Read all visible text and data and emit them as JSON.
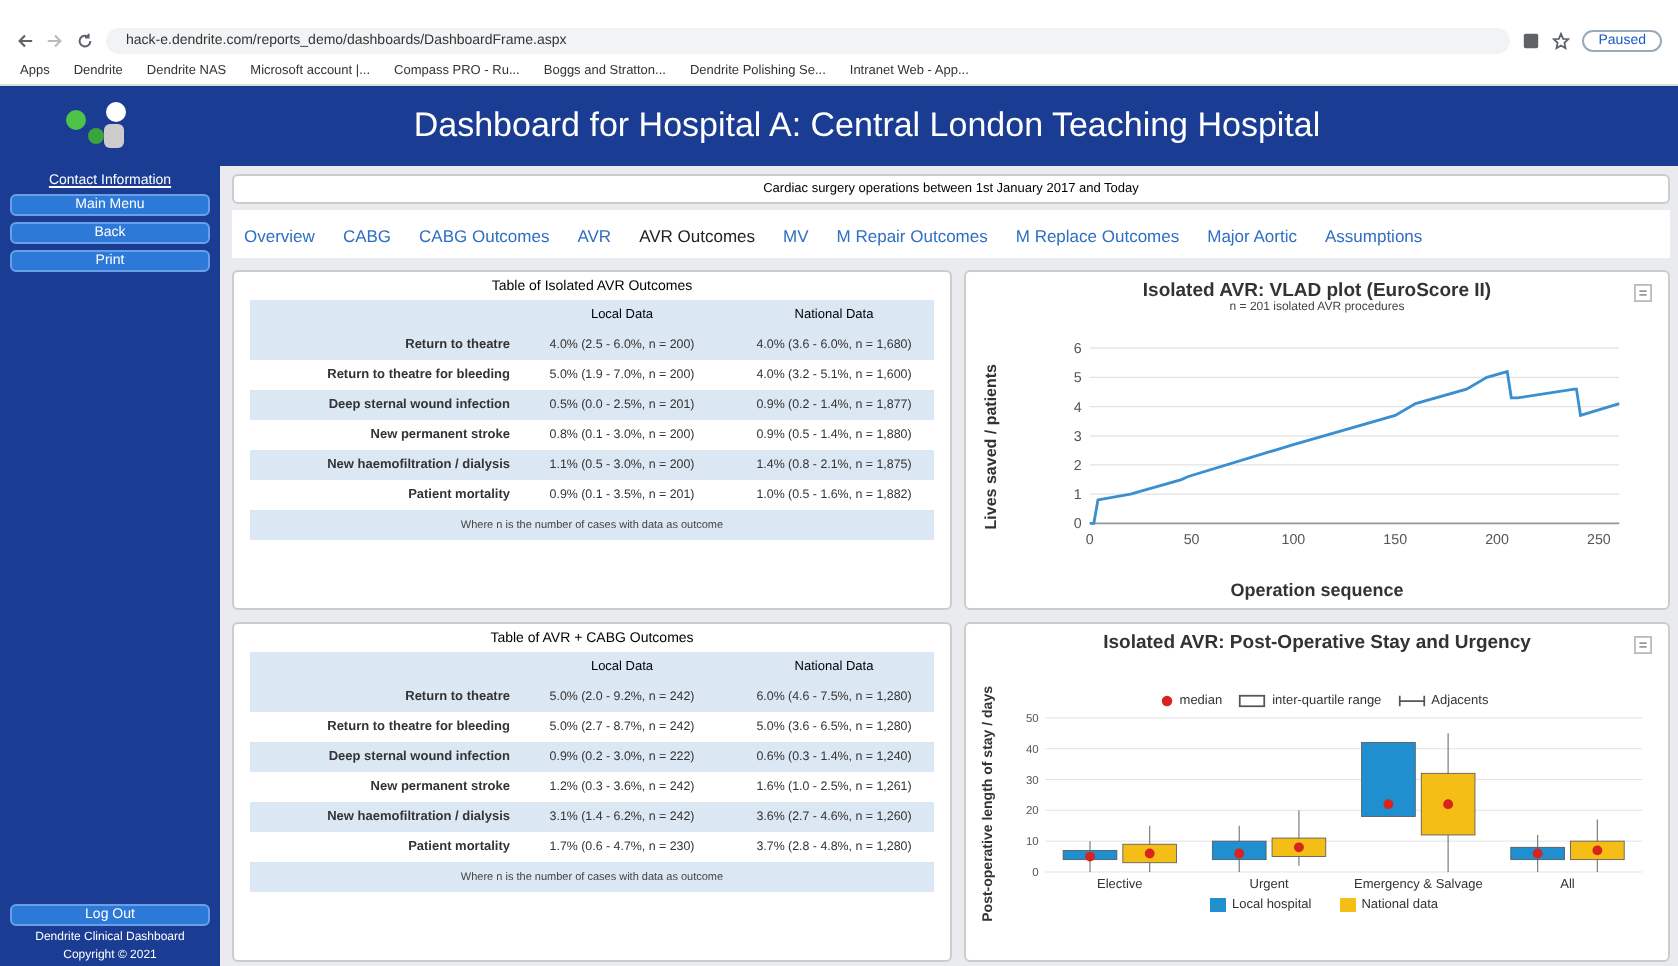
{
  "browser": {
    "url": "hack-e.dendrite.com/reports_demo/dashboards/DashboardFrame.aspx",
    "profile": "Paused",
    "bookmarks": [
      "Apps",
      "Dendrite",
      "Dendrite NAS",
      "Microsoft account |...",
      "Compass PRO - Ru...",
      "Boggs and Stratton...",
      "Dendrite Polishing Se...",
      "Intranet Web - App..."
    ]
  },
  "header": {
    "title": "Dashboard for Hospital A: Central London Teaching Hospital"
  },
  "sidebar": {
    "contact": "Contact Information",
    "buttons": [
      "Main Menu",
      "Back",
      "Print"
    ],
    "logout": "Log Out",
    "footer": [
      "Dendrite Clinical Dashboard",
      "Copyright © 2021"
    ]
  },
  "banner": "Cardiac surgery operations between 1st January 2017 and Today",
  "tabs": [
    {
      "label": "Overview",
      "selected": false
    },
    {
      "label": "CABG",
      "selected": false
    },
    {
      "label": "CABG Outcomes",
      "selected": false
    },
    {
      "label": "AVR",
      "selected": false
    },
    {
      "label": "AVR Outcomes",
      "selected": true
    },
    {
      "label": "MV",
      "selected": false
    },
    {
      "label": "M Repair Outcomes",
      "selected": false
    },
    {
      "label": "M Replace Outcomes",
      "selected": false
    },
    {
      "label": "Major Aortic",
      "selected": false
    },
    {
      "label": "Assumptions",
      "selected": false
    }
  ],
  "tables": [
    {
      "title": "Table of Isolated AVR Outcomes",
      "columns": [
        "Local Data",
        "National Data"
      ],
      "rows": [
        {
          "label": "Return to theatre",
          "local": "4.0% (2.5 - 6.0%, n = 200)",
          "national": "4.0% (3.6 - 6.0%, n = 1,680)"
        },
        {
          "label": "Return to theatre for bleeding",
          "local": "5.0% (1.9 - 7.0%, n = 200)",
          "national": "4.0% (3.2 - 5.1%, n = 1,600)"
        },
        {
          "label": "Deep sternal wound infection",
          "local": "0.5% (0.0 - 2.5%, n = 201)",
          "national": "0.9% (0.2 - 1.4%, n = 1,877)"
        },
        {
          "label": "New permanent stroke",
          "local": "0.8% (0.1 - 3.0%, n = 200)",
          "national": "0.9% (0.5 - 1.4%, n = 1,880)"
        },
        {
          "label": "New haemofiltration / dialysis",
          "local": "1.1% (0.5 - 3.0%, n = 200)",
          "national": "1.4% (0.8 - 2.1%, n = 1,875)"
        },
        {
          "label": "Patient mortality",
          "local": "0.9% (0.1 - 3.5%, n = 201)",
          "national": "1.0% (0.5 - 1.6%, n = 1,882)"
        }
      ],
      "note": "Where n is the number of cases with data as outcome"
    },
    {
      "title": "Table of AVR + CABG Outcomes",
      "columns": [
        "Local Data",
        "National Data"
      ],
      "rows": [
        {
          "label": "Return to theatre",
          "local": "5.0% (2.0 - 9.2%, n = 242)",
          "national": "6.0% (4.6 - 7.5%, n = 1,280)"
        },
        {
          "label": "Return to theatre for bleeding",
          "local": "5.0% (2.7 - 8.7%, n = 242)",
          "national": "5.0% (3.6 - 6.5%, n = 1,280)"
        },
        {
          "label": "Deep sternal wound infection",
          "local": "0.9% (0.2 - 3.0%, n = 222)",
          "national": "0.6% (0.3 - 1.4%, n = 1,240)"
        },
        {
          "label": "New permanent stroke",
          "local": "1.2% (0.3 - 3.6%, n = 242)",
          "national": "1.6% (1.0 - 2.5%, n = 1,261)"
        },
        {
          "label": "New haemofiltration / dialysis",
          "local": "3.1% (1.4 - 6.2%, n = 242)",
          "national": "3.6% (2.7 - 4.6%, n = 1,260)"
        },
        {
          "label": "Patient mortality",
          "local": "1.7% (0.6 - 4.7%, n = 230)",
          "national": "3.7% (2.8 - 4.8%, n = 1,280)"
        }
      ],
      "note": "Where n is the number of cases with data as outcome"
    }
  ],
  "vlad": {
    "chart_data": {
      "type": "line",
      "title": "Isolated AVR: VLAD plot (EuroScore II)",
      "subtitle": "n = 201 isolated AVR procedures",
      "xlabel": "Operation sequence",
      "ylabel": "Lives saved / patients",
      "x": [
        0,
        2,
        4,
        20,
        45,
        48,
        100,
        150,
        160,
        185,
        195,
        205,
        207,
        210,
        238,
        239,
        241,
        260
      ],
      "grid": true,
      "series": [
        {
          "color": "#3a8fd0",
          "values": [
            0,
            0,
            0.8,
            1.0,
            1.5,
            1.6,
            2.7,
            3.7,
            4.1,
            4.6,
            5.0,
            5.2,
            4.3,
            4.3,
            4.6,
            4.6,
            3.7,
            4.1
          ]
        }
      ],
      "xlim": [
        0,
        260
      ],
      "ylim": [
        0,
        6
      ],
      "xticks": [
        0,
        50,
        100,
        150,
        200,
        250
      ],
      "yticks": [
        0,
        1,
        2,
        3,
        4,
        5,
        6
      ]
    }
  },
  "stay": {
    "title": "Isolated AVR: Post-Operative Stay and Urgency",
    "ylabel": "Post-operative length of stay / days",
    "yticks": [
      "50",
      "40",
      "30",
      "20",
      "10",
      "0"
    ],
    "categories": [
      "Elective",
      "Urgent",
      "Emergency & Salvage",
      "All"
    ],
    "legend": [
      "median",
      "inter-quartile range",
      "Adjacents"
    ],
    "series": [
      "Local hospital",
      "National data"
    ]
  }
}
